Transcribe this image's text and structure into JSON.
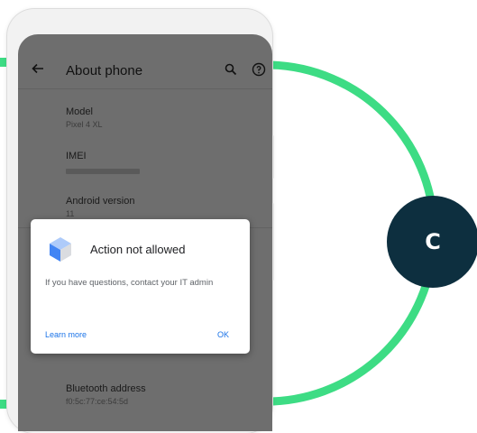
{
  "colors": {
    "accent_green": "#3ddc84",
    "badge_navy": "#0d2f3f",
    "link_blue": "#1a73e8",
    "screen_dim": "#6e6e6e"
  },
  "badge": {
    "letter": "C"
  },
  "appbar": {
    "title": "About phone",
    "back_icon": "arrow-left-icon",
    "search_icon": "search-icon",
    "help_icon": "help-circle-icon"
  },
  "settings": {
    "model": {
      "label": "Model",
      "value": "Pixel 4 XL"
    },
    "imei": {
      "label": "IMEI"
    },
    "android": {
      "label": "Android version",
      "value": "11"
    },
    "bluetooth": {
      "label": "Bluetooth address",
      "value": "f0:5c:77:ce:54:5d"
    }
  },
  "dialog": {
    "icon": "device-policy-icon",
    "title": "Action not allowed",
    "body": "If you have questions, contact your IT admin",
    "learn_more": "Learn more",
    "ok": "OK"
  }
}
